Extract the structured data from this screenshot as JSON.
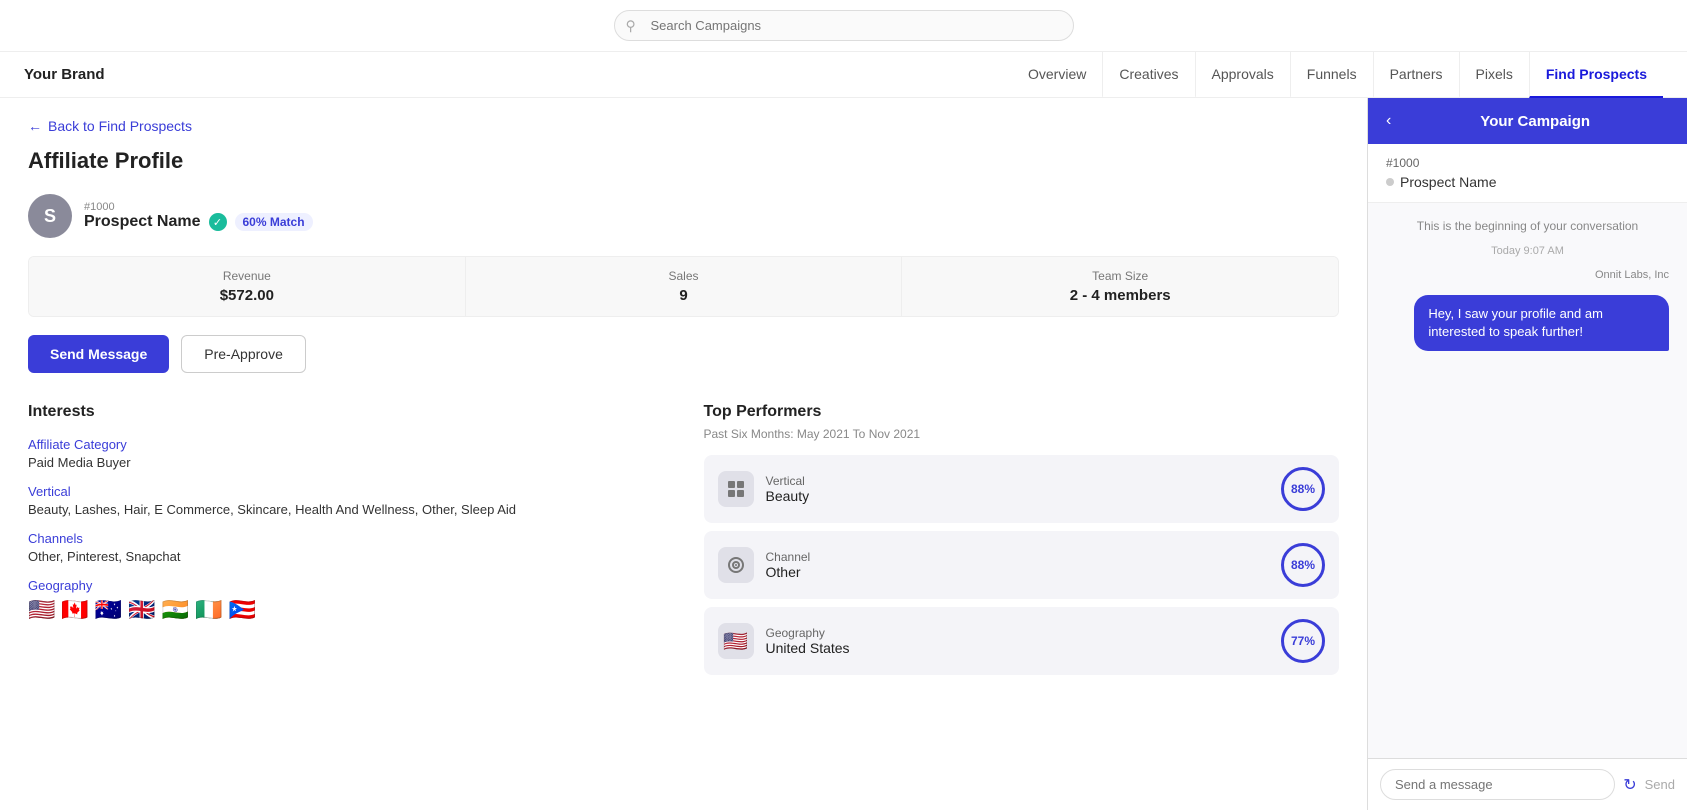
{
  "topbar": {
    "search_placeholder": "Search Campaigns"
  },
  "nav": {
    "brand": "Your Brand",
    "items": [
      {
        "label": "Overview",
        "active": false
      },
      {
        "label": "Creatives",
        "active": false
      },
      {
        "label": "Approvals",
        "active": false
      },
      {
        "label": "Funnels",
        "active": false
      },
      {
        "label": "Partners",
        "active": false
      },
      {
        "label": "Pixels",
        "active": false
      },
      {
        "label": "Find Prospects",
        "active": true
      }
    ]
  },
  "backLink": "Back to Find Prospects",
  "pageTitle": "Affiliate Profile",
  "profile": {
    "id": "#1000",
    "avatarInitial": "S",
    "name": "Prospect Name",
    "verified": true,
    "matchLabel": "60% Match",
    "stats": [
      {
        "label": "Revenue",
        "value": "$572.00"
      },
      {
        "label": "Sales",
        "value": "9"
      },
      {
        "label": "Team Size",
        "value": "2 - 4 members"
      }
    ],
    "buttons": {
      "send": "Send Message",
      "approve": "Pre-Approve"
    }
  },
  "interests": {
    "title": "Interests",
    "groups": [
      {
        "label": "Affiliate Category",
        "value": "Paid Media Buyer"
      },
      {
        "label": "Vertical",
        "value": "Beauty, Lashes, Hair, E Commerce, Skincare, Health And Wellness, Other, Sleep Aid"
      },
      {
        "label": "Channels",
        "value": "Other, Pinterest, Snapchat"
      },
      {
        "label": "Geography",
        "value": ""
      }
    ],
    "flags": [
      "🇺🇸",
      "🇨🇦",
      "🇦🇺",
      "🇬🇧",
      "🇮🇳",
      "🇮🇪",
      "🇵🇷"
    ]
  },
  "performers": {
    "title": "Top Performers",
    "subtitle": "Past Six Months: May 2021 To Nov 2021",
    "items": [
      {
        "type": "Vertical",
        "name": "Beauty",
        "pct": "88%",
        "icon": "grid"
      },
      {
        "type": "Channel",
        "name": "Other",
        "pct": "88%",
        "icon": "target"
      },
      {
        "type": "Geography",
        "name": "United States",
        "pct": "77%",
        "icon": "flag"
      }
    ]
  },
  "rightPanel": {
    "title": "Your Campaign",
    "campaignNum": "#1000",
    "prospectLabel": "Prospect Name",
    "systemMsg": "This is the beginning of your conversation",
    "chatTime": "Today 9:07 AM",
    "senderLabel": "Onnit Labs, Inc",
    "chatBubble": "Hey, I saw your profile and am interested to speak further!",
    "inputPlaceholder": "Send a message",
    "sendLabel": "Send"
  }
}
